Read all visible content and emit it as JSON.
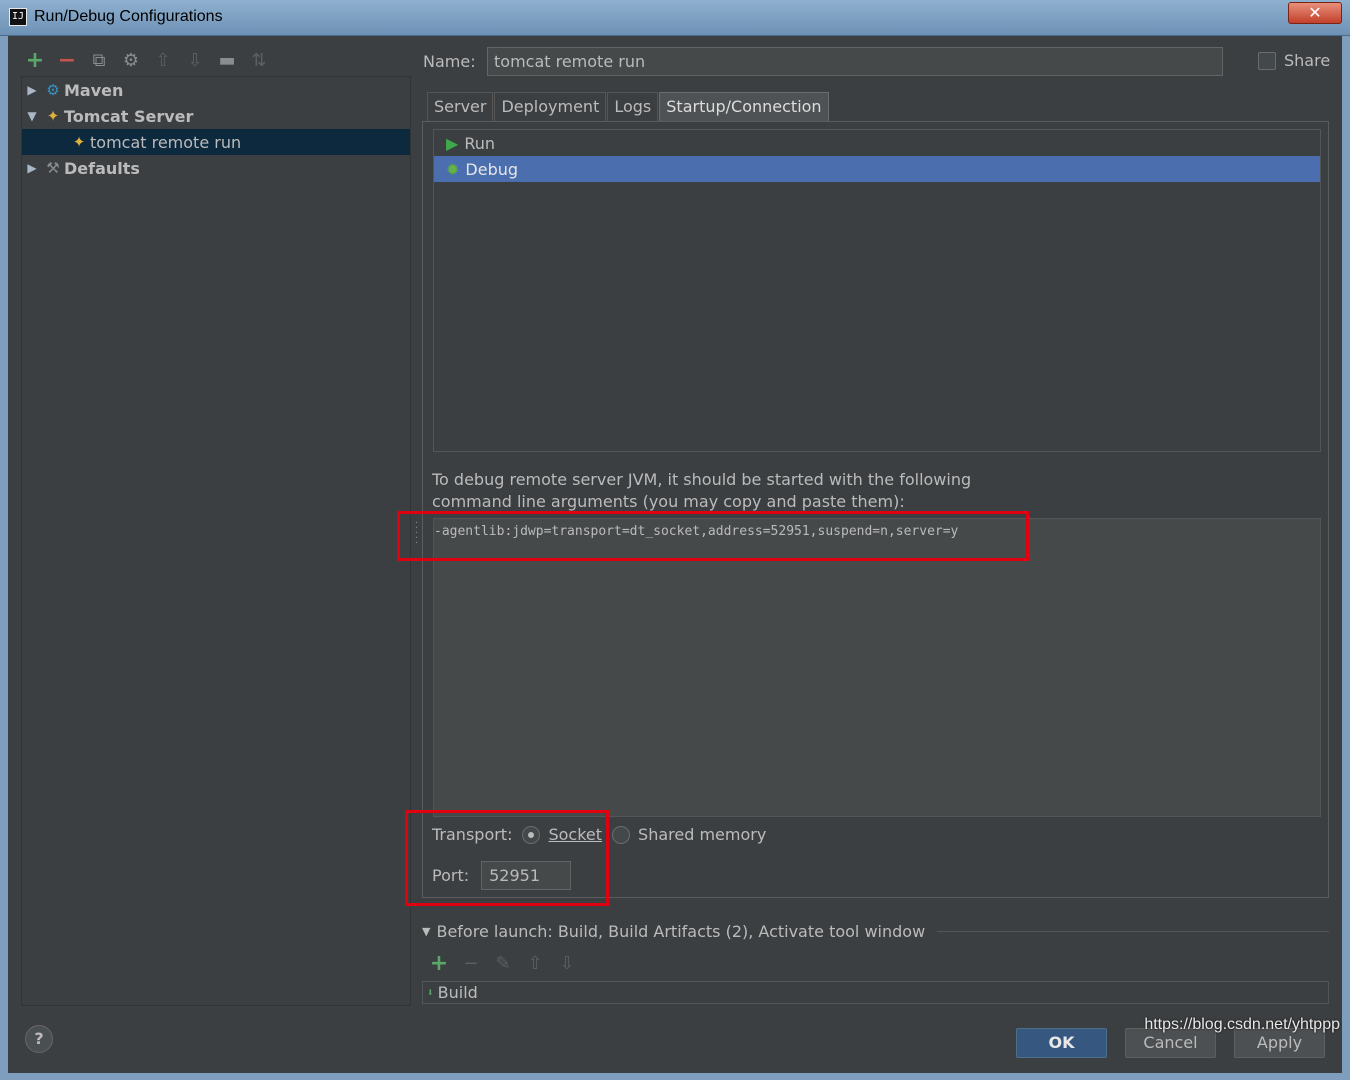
{
  "window": {
    "title": "Run/Debug Configurations",
    "close_glyph": "✕"
  },
  "toolbar": {
    "add": "+",
    "remove": "−",
    "copy": "⧉",
    "edit_defaults": "⚙",
    "move_up": "⇧",
    "move_down": "⇩",
    "folder": "▬",
    "sort": "⇅"
  },
  "tree": {
    "items": [
      {
        "label": "Maven",
        "arrow": "▶",
        "icon": "⚙"
      },
      {
        "label": "Tomcat Server",
        "arrow": "▼",
        "icon": "✦"
      },
      {
        "label": "tomcat remote run",
        "icon": "✦"
      },
      {
        "label": "Defaults",
        "arrow": "▶",
        "icon": "⚒"
      }
    ]
  },
  "form": {
    "name_label": "Name:",
    "name_value": "tomcat remote run",
    "share_label": "Share"
  },
  "tabs": [
    {
      "label": "Server"
    },
    {
      "label": "Deployment"
    },
    {
      "label": "Logs"
    },
    {
      "label": "Startup/Connection"
    }
  ],
  "modes": [
    {
      "label": "Run",
      "icon": "▶"
    },
    {
      "label": "Debug",
      "icon": "✹"
    }
  ],
  "hint": {
    "line1": "To debug remote server JVM, it should be started with the following",
    "line2": "command line arguments (you may copy and paste them):"
  },
  "args": "-agentlib:jdwp=transport=dt_socket,address=52951,suspend=n,server=y",
  "transport": {
    "label": "Transport:",
    "socket_label": "Socket",
    "shared_memory_label": "Shared memory"
  },
  "port": {
    "label": "Port:",
    "value": "52951"
  },
  "before_launch": {
    "title": "Before launch: Build, Build Artifacts (2), Activate tool window",
    "toolbar": {
      "add": "+",
      "remove": "−",
      "edit": "✎",
      "up": "⇧",
      "down": "⇩"
    },
    "items": [
      {
        "label": "Build"
      }
    ]
  },
  "buttons": {
    "help": "?",
    "ok": "OK",
    "cancel": "Cancel",
    "apply": "Apply"
  },
  "watermark": "https://blog.csdn.net/yhtppp"
}
